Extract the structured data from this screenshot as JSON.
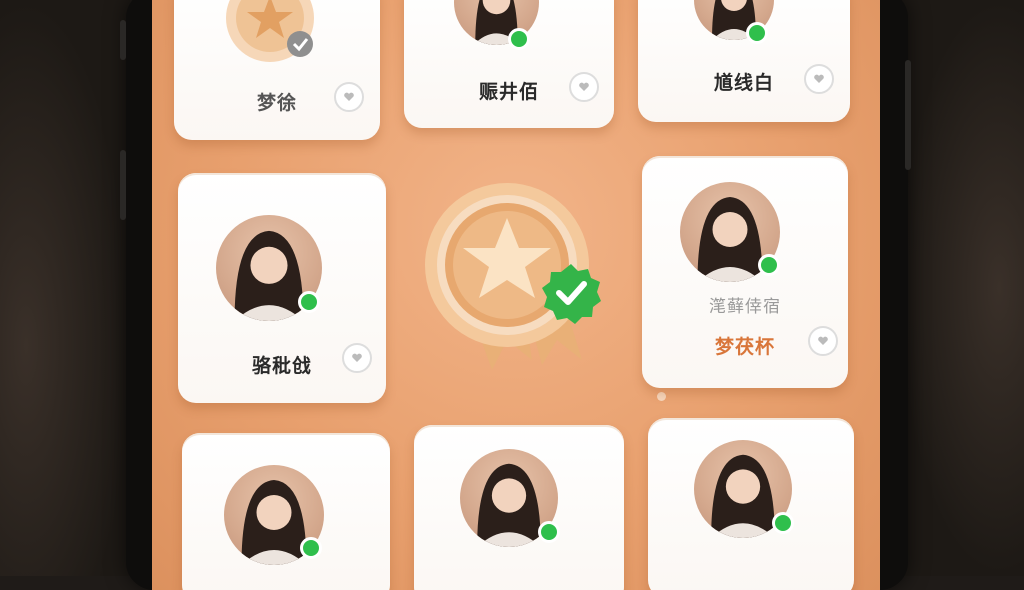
{
  "profiles": {
    "card_1": {
      "name": "梦徐"
    },
    "card_2": {
      "name": "赈井佰"
    },
    "card_3": {
      "name": "馗线白"
    },
    "card_4": {
      "name": "骆秕戗"
    },
    "card_5": {
      "subtitle": "滗藓倖宿",
      "name": "梦茯杯"
    },
    "card_6": {
      "name": ""
    },
    "card_7": {
      "name": ""
    },
    "card_8": {
      "name": ""
    }
  },
  "colors": {
    "background": "#e8a06e",
    "card": "#ffffff",
    "online": "#2fbf4c",
    "accent_orange": "#d9763a",
    "verified_badge": "#2fbf4c"
  },
  "icons": [
    "star-medal-icon",
    "verified-check-icon",
    "heart-icon",
    "online-status-icon"
  ]
}
